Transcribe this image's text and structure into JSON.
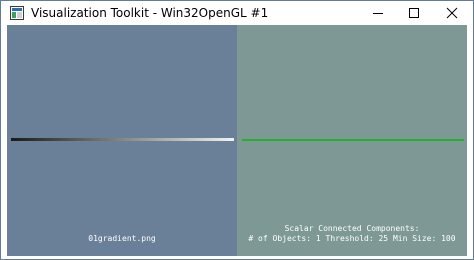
{
  "window": {
    "title": "Visualization Toolkit - Win32OpenGL #1",
    "icon": "vtk-app-icon",
    "controls": {
      "minimize_icon": "minimize-icon",
      "maximize_icon": "maximize-icon",
      "close_icon": "close-icon"
    }
  },
  "left_view": {
    "background": "#6a7f98",
    "caption": "01gradient.png",
    "gradient_from": "#1a1a1a",
    "gradient_to": "#f2f2f2"
  },
  "right_view": {
    "background": "#7e9995",
    "line_color": "#22b22a",
    "caption_line1": "Scalar Connected Components:",
    "caption_line2_prefix": "# of Objects: ",
    "objects": "1",
    "threshold_label": " Threshold: ",
    "threshold": "25",
    "min_size_label": " Min Size: ",
    "min_size": "100"
  }
}
